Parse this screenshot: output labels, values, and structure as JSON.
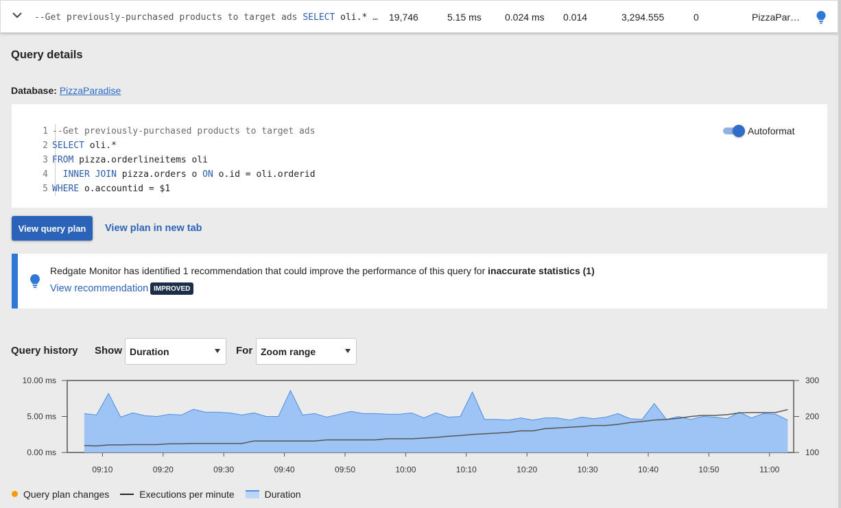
{
  "top_row": {
    "sql_comment": "--Get previously-purchased products to target ads",
    "sql_select": "SELECT",
    "sql_rest": "oli.* F…",
    "executions": "19,746",
    "avg_duration": "5.15 ms",
    "avg_cpu": "0.024 ms",
    "col4": "0.014",
    "col5": "3,294.555",
    "col6": "0",
    "database": "PizzaPar…",
    "icons": [
      "chevron-down-icon",
      "lightbulb-icon"
    ]
  },
  "details": {
    "title": "Query details",
    "db_label": "Database:",
    "db_name": "PizzaParadise"
  },
  "code": {
    "line_numbers": [
      "1",
      "2",
      "3",
      "4",
      "5"
    ],
    "lines": [
      {
        "parts": [
          {
            "t": "--Get previously-purchased products to target ads",
            "k": "cm"
          }
        ]
      },
      {
        "parts": [
          {
            "t": "SELECT",
            "k": "kw"
          },
          {
            "t": " oli.*",
            "k": "p"
          }
        ]
      },
      {
        "parts": [
          {
            "t": "FROM",
            "k": "kw"
          },
          {
            "t": " pizza.orderlineitems oli",
            "k": "p"
          }
        ]
      },
      {
        "parts": [
          {
            "t": "  ",
            "k": "p"
          },
          {
            "t": "INNER JOIN",
            "k": "kw"
          },
          {
            "t": " pizza.orders o ",
            "k": "p"
          },
          {
            "t": "ON",
            "k": "kw"
          },
          {
            "t": " o.id = oli.orderid",
            "k": "p"
          }
        ]
      },
      {
        "parts": [
          {
            "t": "WHERE",
            "k": "kw"
          },
          {
            "t": " o.accountid = $1",
            "k": "p"
          }
        ]
      }
    ],
    "autoformat_label": "Autoformat",
    "autoformat_on": true
  },
  "actions": {
    "view_plan": "View query plan",
    "view_plan_new_tab": "View plan in new tab"
  },
  "recommendation": {
    "text": "Redgate Monitor has identified 1 recommendation that could improve the performance of this query for ",
    "bold": "inaccurate statistics (1)",
    "link": "View recommendation",
    "badge": "IMPROVED"
  },
  "history": {
    "title": "Query history",
    "show_label": "Show",
    "show_value": "Duration",
    "for_label": "For",
    "for_value": "Zoom range"
  },
  "colors": {
    "accent": "#2b63b8",
    "duration_fill": "#9ec4f5",
    "duration_line": "#4a8fe0",
    "executions_line": "#555555",
    "plan_change": "#f59b00"
  },
  "chart_data": {
    "type": "area",
    "x": [
      "09:07",
      "09:09",
      "09:11",
      "09:13",
      "09:15",
      "09:17",
      "09:19",
      "09:21",
      "09:23",
      "09:25",
      "09:27",
      "09:29",
      "09:31",
      "09:33",
      "09:35",
      "09:37",
      "09:39",
      "09:41",
      "09:43",
      "09:45",
      "09:47",
      "09:49",
      "09:51",
      "09:53",
      "09:55",
      "09:57",
      "09:59",
      "10:01",
      "10:03",
      "10:05",
      "10:07",
      "10:09",
      "10:11",
      "10:13",
      "10:15",
      "10:17",
      "10:19",
      "10:21",
      "10:23",
      "10:25",
      "10:27",
      "10:29",
      "10:31",
      "10:33",
      "10:35",
      "10:37",
      "10:39",
      "10:41",
      "10:43",
      "10:45",
      "10:47",
      "10:49",
      "10:51",
      "10:53",
      "10:55",
      "10:57",
      "10:59",
      "11:01",
      "11:03"
    ],
    "x_ticks": [
      "09:10",
      "09:20",
      "09:30",
      "09:40",
      "09:50",
      "10:00",
      "10:10",
      "10:20",
      "10:30",
      "10:40",
      "10:50",
      "11:00"
    ],
    "y_left_ticks": [
      "0.00 ms",
      "5.00 ms",
      "10.00 ms"
    ],
    "y_left_range": [
      0,
      10
    ],
    "y_right_ticks": [
      "100",
      "200",
      "300"
    ],
    "y_right_range": [
      100,
      300
    ],
    "series": [
      {
        "name": "Duration",
        "axis": "left",
        "values": [
          5.4,
          5.2,
          8.2,
          4.9,
          5.5,
          5.1,
          5.0,
          5.3,
          5.2,
          6.0,
          5.6,
          5.6,
          5.5,
          5.2,
          5.5,
          5.0,
          5.0,
          8.6,
          5.2,
          5.4,
          4.9,
          5.3,
          5.7,
          5.4,
          5.4,
          5.3,
          5.3,
          5.5,
          4.8,
          5.5,
          4.9,
          5.0,
          8.4,
          4.6,
          4.6,
          4.5,
          4.8,
          4.5,
          4.8,
          4.8,
          4.5,
          4.9,
          4.7,
          4.9,
          5.4,
          4.7,
          4.6,
          6.8,
          4.6,
          5.0,
          4.6,
          5.0,
          4.9,
          4.7,
          5.6,
          4.8,
          5.4,
          5.3,
          4.5
        ]
      },
      {
        "name": "Executions per minute",
        "axis": "right",
        "values": [
          119,
          118,
          121,
          121,
          122,
          122,
          122,
          124,
          124,
          125,
          125,
          125,
          125,
          125,
          132,
          132,
          132,
          132,
          132,
          132,
          135,
          135,
          135,
          135,
          135,
          138,
          138,
          138,
          140,
          142,
          145,
          147,
          150,
          152,
          154,
          156,
          160,
          160,
          166,
          168,
          170,
          172,
          175,
          175,
          178,
          183,
          186,
          190,
          192,
          195,
          200,
          203,
          203,
          205,
          210,
          211,
          211,
          211,
          219
        ]
      },
      {
        "name": "Query plan changes",
        "axis": "left",
        "values": []
      }
    ],
    "grid": false,
    "legend_position": "bottom-left"
  }
}
